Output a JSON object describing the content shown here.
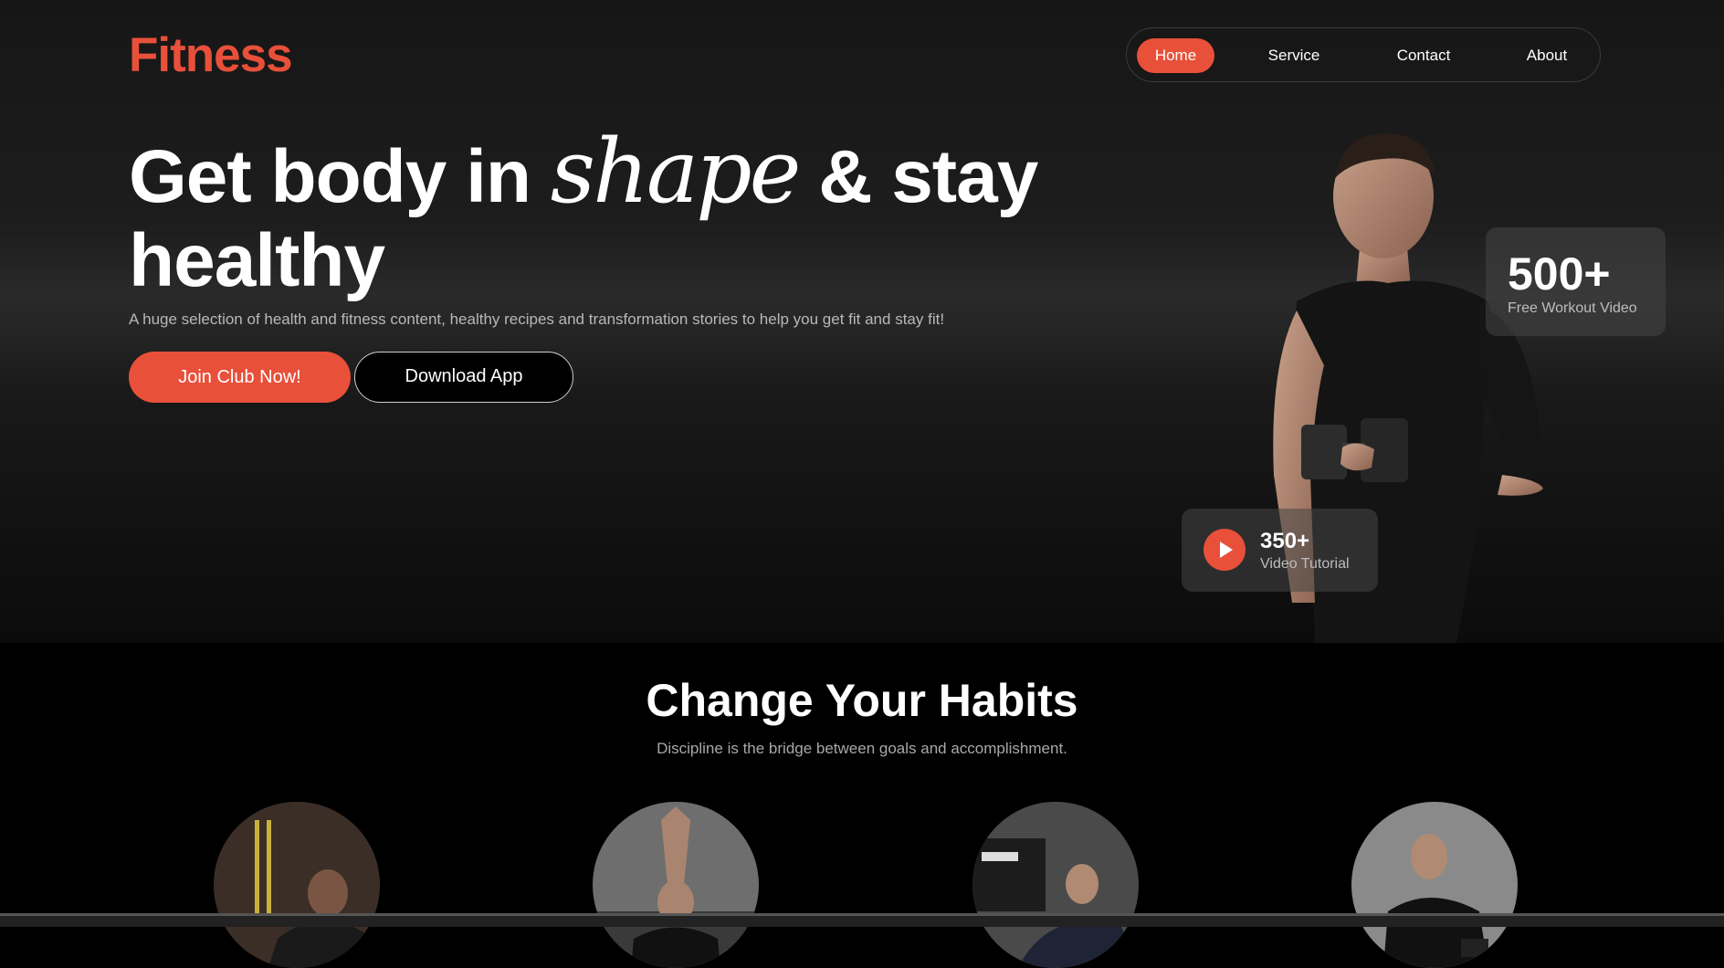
{
  "brand": {
    "logo": "Fitness",
    "accent_color": "#e8503a"
  },
  "nav": {
    "items": [
      {
        "label": "Home",
        "active": true
      },
      {
        "label": "Service",
        "active": false
      },
      {
        "label": "Contact",
        "active": false
      },
      {
        "label": "About",
        "active": false
      }
    ]
  },
  "hero": {
    "headline_part1": "Get body in",
    "headline_script": "shape",
    "headline_part2": "& stay",
    "headline_line2": "healthy",
    "subtitle": "A huge selection of health and fitness content, healthy recipes and transformation stories to help you get fit and stay fit!",
    "primary_button": "Join Club Now!",
    "secondary_button": "Download App"
  },
  "stats": {
    "workouts": {
      "value": "500+",
      "label": "Free Workout Video"
    },
    "tutorials": {
      "value": "350+",
      "label": "Video Tutorial",
      "icon": "play-icon"
    }
  },
  "habits": {
    "title": "Change Your Habits",
    "subtitle": "Discipline is the bridge between goals and accomplishment.",
    "images": [
      {
        "icon": "trx-training-photo"
      },
      {
        "icon": "stretching-photo"
      },
      {
        "icon": "gym-workout-photo"
      },
      {
        "icon": "dumbbell-photo"
      }
    ]
  }
}
